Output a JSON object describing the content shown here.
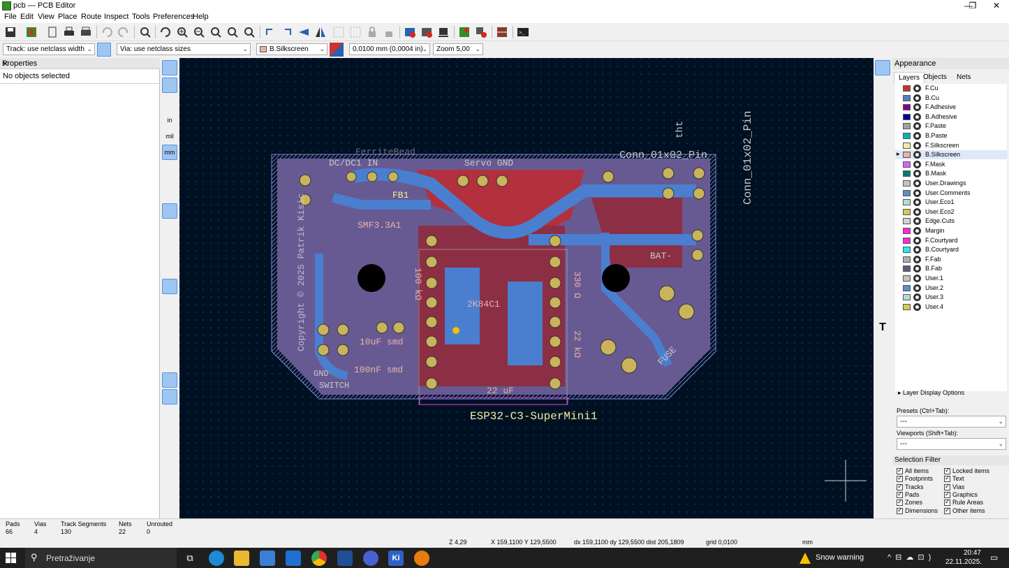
{
  "window": {
    "title": "pcb — PCB Editor"
  },
  "menu": [
    "File",
    "Edit",
    "View",
    "Place",
    "Route",
    "Inspect",
    "Tools",
    "Preferences",
    "Help"
  ],
  "toolbar2": {
    "track": "Track: use netclass width",
    "via": "Via: use netclass sizes",
    "layer": "B.Silkscreen",
    "grid": "0,0100 mm (0,0004 in)",
    "zoom": "Zoom 5,00"
  },
  "properties": {
    "title": "Properties",
    "close": "✕",
    "empty": "No objects selected"
  },
  "appearance": {
    "title": "Appearance",
    "tabs": [
      "Layers",
      "Objects",
      "Nets"
    ],
    "layers": [
      {
        "name": "F.Cu",
        "color": "#c83434"
      },
      {
        "name": "B.Cu",
        "color": "#4d7fc4"
      },
      {
        "name": "F.Adhesive",
        "color": "#84008a"
      },
      {
        "name": "B.Adhesive",
        "color": "#0000a0"
      },
      {
        "name": "F.Paste",
        "color": "#a0a0a0"
      },
      {
        "name": "B.Paste",
        "color": "#00b4b4"
      },
      {
        "name": "F.Silkscreen",
        "color": "#f2eda1"
      },
      {
        "name": "B.Silkscreen",
        "color": "#e8b2a7"
      },
      {
        "name": "F.Mask",
        "color": "#d864ff"
      },
      {
        "name": "B.Mask",
        "color": "#027d6e"
      },
      {
        "name": "User.Drawings",
        "color": "#c2c2c2"
      },
      {
        "name": "User.Comments",
        "color": "#5990c9"
      },
      {
        "name": "User.Eco1",
        "color": "#b4dbd2"
      },
      {
        "name": "User.Eco2",
        "color": "#d8c852"
      },
      {
        "name": "Edge.Cuts",
        "color": "#d0d2cd"
      },
      {
        "name": "Margin",
        "color": "#ff26e2"
      },
      {
        "name": "F.Courtyard",
        "color": "#ff26e2"
      },
      {
        "name": "B.Courtyard",
        "color": "#26e9ff"
      },
      {
        "name": "F.Fab",
        "color": "#afafaf"
      },
      {
        "name": "B.Fab",
        "color": "#585d84"
      },
      {
        "name": "User.1",
        "color": "#c2c2c2"
      },
      {
        "name": "User.2",
        "color": "#5990c9"
      },
      {
        "name": "User.3",
        "color": "#b4dbd2"
      },
      {
        "name": "User.4",
        "color": "#d8c852"
      }
    ],
    "layer_display_options": "Layer Display Options",
    "presets_label": "Presets (Ctrl+Tab):",
    "presets_value": "---",
    "viewports_label": "Viewports (Shift+Tab):",
    "viewports_value": "---"
  },
  "selection_filter": {
    "title": "Selection Filter",
    "items": [
      "All items",
      "Locked items",
      "Footprints",
      "Text",
      "Tracks",
      "Vias",
      "Pads",
      "Graphics",
      "Zones",
      "Rule Areas",
      "Dimensions",
      "Other items"
    ]
  },
  "board_text": {
    "title": "ESP32-C3-SuperMini1",
    "conn_right": "Conn_01x02_Pin",
    "conn_top": "Conn_01x02_Pin",
    "copyright": "Copyright © 2025 Patrik Kisic",
    "servo": "Servo GND",
    "dcdc": "DC/DC1 IN",
    "fb1": "FB1",
    "smf": "SMF3.3A1",
    "cap1": "10uF smd",
    "cap2": "100nF smd",
    "cap3": "22 uF",
    "gnd": "GND",
    "switch": "SWITCH",
    "bat": "BAT-",
    "fuse": "FUSE",
    "r330": "330 Ω",
    "r22k": "22 kΩ",
    "r100k": "100 kΩ",
    "chip": "2K84C1",
    "ferrite": "FerriteBead",
    "tht": "tht"
  },
  "status": {
    "pads_label": "Pads",
    "pads": "66",
    "vias_label": "Vias",
    "vias": "4",
    "tracks_label": "Track Segments",
    "tracks": "130",
    "nets_label": "Nets",
    "nets": "22",
    "unrouted_label": "Unrouted",
    "unrouted": "0",
    "z": "Z 4,29",
    "xy": "X 159,1100  Y 129,5500",
    "dxy": "dx 159,1100  dy 129,5500  dist 205,1809",
    "grid": "grid 0,0100",
    "units": "mm"
  },
  "taskbar": {
    "search": "Pretraživanje",
    "weather": "Snow warning",
    "time": "20:47",
    "date": "22.11.2025."
  }
}
